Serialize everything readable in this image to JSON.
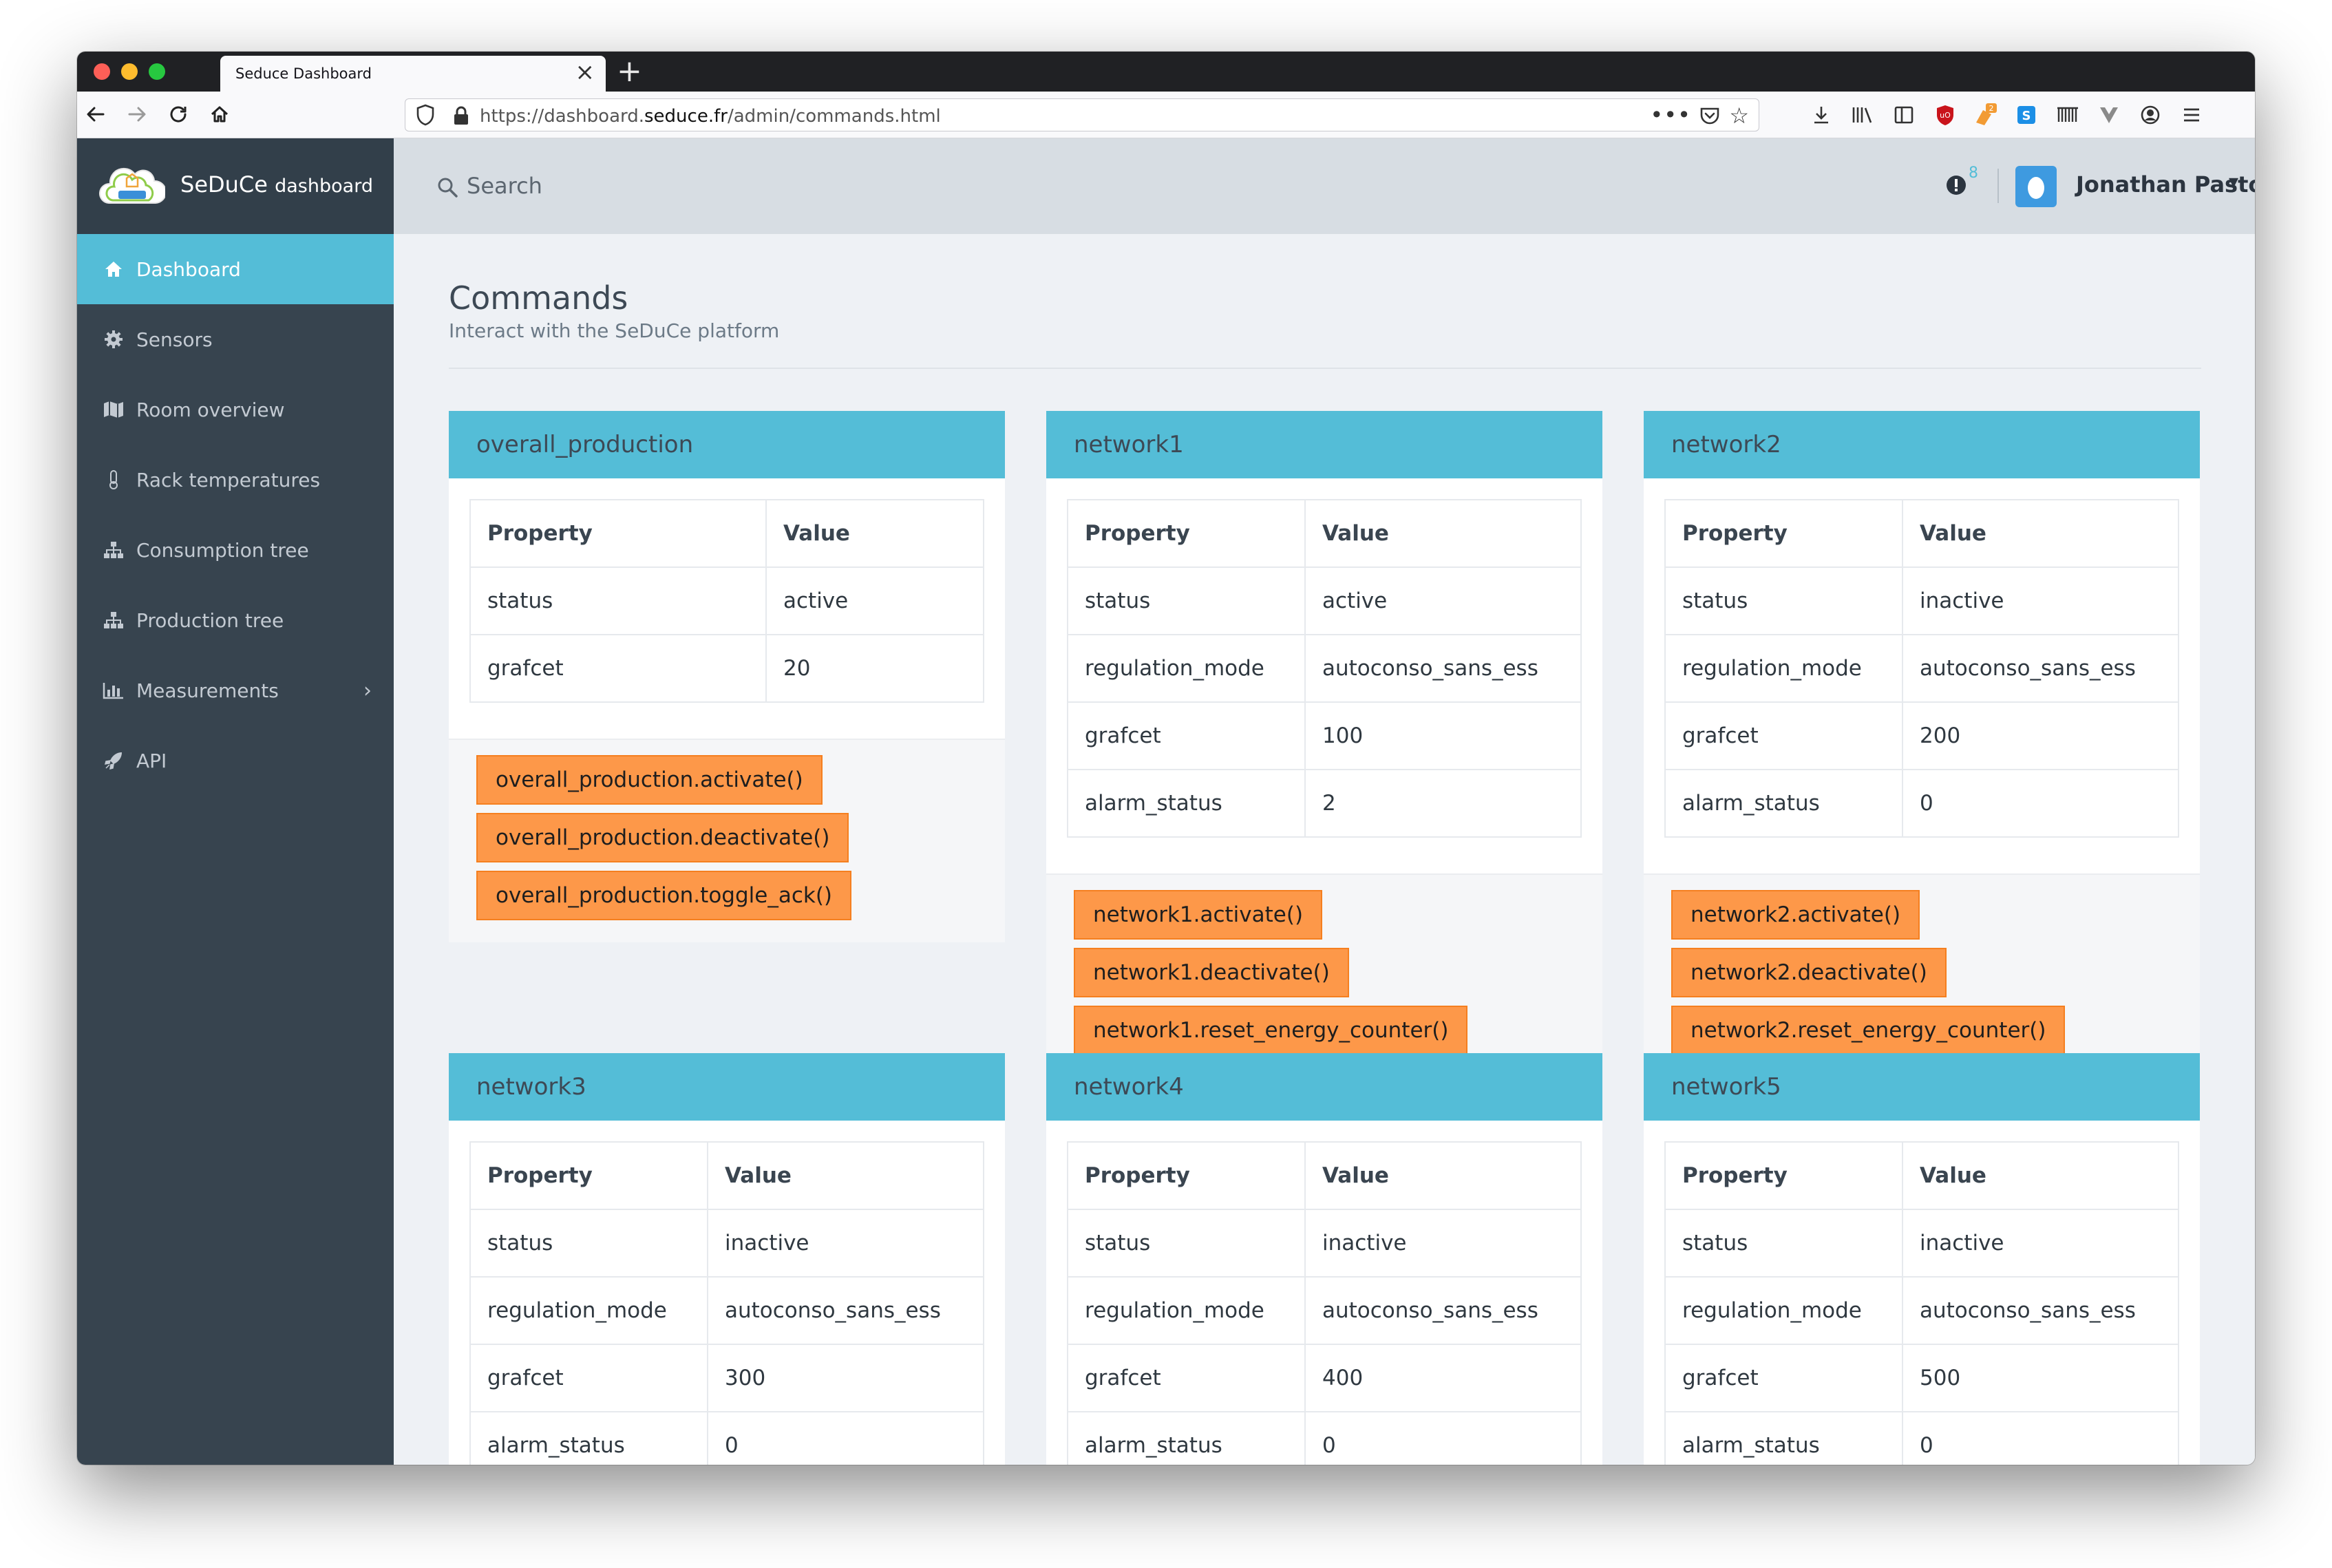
{
  "browser": {
    "tab_title": "Seduce Dashboard",
    "url_prefix": "https://dashboard.",
    "url_host": "seduce.fr",
    "url_path": "/admin/commands.html",
    "ublock_badge": "2"
  },
  "brand": {
    "name": "SeDuCe",
    "suffix": "dashboard"
  },
  "sidebar": {
    "items": [
      {
        "label": "Dashboard",
        "icon": "home-icon"
      },
      {
        "label": "Sensors",
        "icon": "gear-icon"
      },
      {
        "label": "Room overview",
        "icon": "map-icon"
      },
      {
        "label": "Rack temperatures",
        "icon": "thermometer-icon"
      },
      {
        "label": "Consumption tree",
        "icon": "sitemap-icon"
      },
      {
        "label": "Production tree",
        "icon": "sitemap-icon"
      },
      {
        "label": "Measurements",
        "icon": "bar-chart-icon"
      },
      {
        "label": "API",
        "icon": "rocket-icon"
      }
    ]
  },
  "header": {
    "search_placeholder": "Search",
    "alert_count": "8",
    "user_name": "Jonathan Pastor"
  },
  "main": {
    "title": "Commands",
    "subtitle": "Interact with the SeDuCe platform",
    "col_property": "Property",
    "col_value": "Value",
    "cards": [
      {
        "title": "overall_production",
        "rows": [
          [
            "status",
            "active"
          ],
          [
            "grafcet",
            "20"
          ]
        ],
        "commands": [
          "overall_production.activate()",
          "overall_production.deactivate()",
          "overall_production.toggle_ack()"
        ]
      },
      {
        "title": "network1",
        "rows": [
          [
            "status",
            "active"
          ],
          [
            "regulation_mode",
            "autoconso_sans_ess"
          ],
          [
            "grafcet",
            "100"
          ],
          [
            "alarm_status",
            "2"
          ]
        ],
        "commands": [
          "network1.activate()",
          "network1.deactivate()",
          "network1.reset_energy_counter()"
        ]
      },
      {
        "title": "network2",
        "rows": [
          [
            "status",
            "inactive"
          ],
          [
            "regulation_mode",
            "autoconso_sans_ess"
          ],
          [
            "grafcet",
            "200"
          ],
          [
            "alarm_status",
            "0"
          ]
        ],
        "commands": [
          "network2.activate()",
          "network2.deactivate()",
          "network2.reset_energy_counter()"
        ]
      },
      {
        "title": "network3",
        "rows": [
          [
            "status",
            "inactive"
          ],
          [
            "regulation_mode",
            "autoconso_sans_ess"
          ],
          [
            "grafcet",
            "300"
          ],
          [
            "alarm_status",
            "0"
          ]
        ],
        "commands": []
      },
      {
        "title": "network4",
        "rows": [
          [
            "status",
            "inactive"
          ],
          [
            "regulation_mode",
            "autoconso_sans_ess"
          ],
          [
            "grafcet",
            "400"
          ],
          [
            "alarm_status",
            "0"
          ]
        ],
        "commands": []
      },
      {
        "title": "network5",
        "rows": [
          [
            "status",
            "inactive"
          ],
          [
            "regulation_mode",
            "autoconso_sans_ess"
          ],
          [
            "grafcet",
            "500"
          ],
          [
            "alarm_status",
            "0"
          ]
        ],
        "commands": []
      }
    ]
  },
  "colors": {
    "accent": "#54bdd7",
    "sidebar": "#37444f",
    "button": "#fd9849",
    "header": "#d7dde3"
  }
}
